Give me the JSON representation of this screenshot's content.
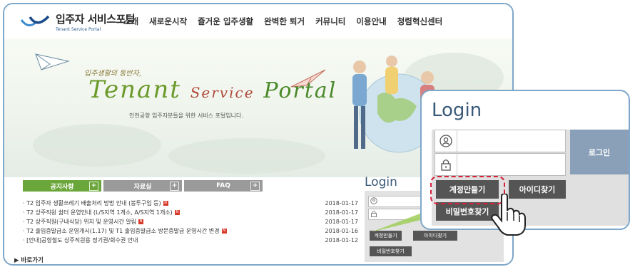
{
  "header": {
    "logo_title": "입주자 서비스포털",
    "logo_sub": "Tenant Service Portal",
    "nav": [
      "소개",
      "새로운시작",
      "즐거운 입주생활",
      "완벽한 퇴거",
      "커뮤니티",
      "이용안내",
      "청렴혁신센터"
    ]
  },
  "hero": {
    "handwriting": "입주생활의 동반자,",
    "brand_1": "Tenant",
    "brand_2": "Service",
    "brand_3": "Portal",
    "subtitle": "인천공항 입주자분들을 위한 서비스 포털입니다."
  },
  "tabs": [
    "공지사항",
    "자료실",
    "FAQ"
  ],
  "notices": [
    {
      "title": "· T2 입주자 생활쓰레기 배출처리 방법 안내 (봉투구입 등)",
      "date": "2018-01-17",
      "new": "N"
    },
    {
      "title": "· T2 상주직원 쉼터 운영안내 (L/S지역 1개소, A/S지역 1개소)",
      "date": "2018-01-17",
      "new": "N"
    },
    {
      "title": "· T2 상주직원(구내식당) 위치 및 운영시간 알림",
      "date": "2018-01-17",
      "new": "N"
    },
    {
      "title": "· T2 출입증발급소 운영개시(1.17) 및 T1 출입증발급소 방문증발급 운영시간 변경",
      "date": "2018-01-16",
      "new": "N"
    },
    {
      "title": "· [안내]공항철도 상주직원용 정기권/회수권 안내",
      "date": "2018-01-12",
      "new": ""
    }
  ],
  "shortcut": "▶  바로가기",
  "small_login": {
    "title": "Login",
    "signup": "계정만들기",
    "find_id": "아이디찾기",
    "find_pw": "비밀번호찾기"
  },
  "popup_login": {
    "title": "Login",
    "login_button": "로그인",
    "signup": "계정만들기",
    "find_id": "아이디찾기",
    "find_pw": "비밀번호찾기"
  }
}
